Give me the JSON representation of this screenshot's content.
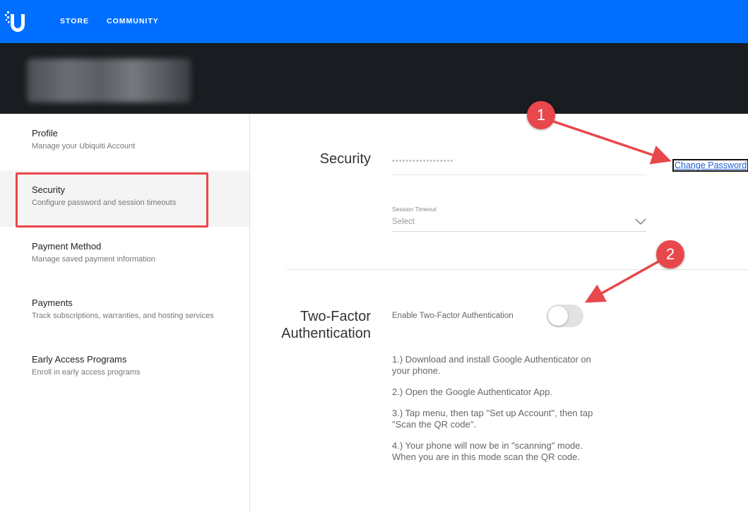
{
  "nav": {
    "store": "STORE",
    "community": "COMMUNITY",
    "brand_color": "#006fff"
  },
  "sidebar": {
    "items": [
      {
        "title": "Profile",
        "desc": "Manage your Ubiquiti Account"
      },
      {
        "title": "Security",
        "desc": "Configure password and session timeouts"
      },
      {
        "title": "Payment Method",
        "desc": "Manage saved payment information"
      },
      {
        "title": "Payments",
        "desc": "Track subscriptions, warranties, and hosting services"
      },
      {
        "title": "Early Access Programs",
        "desc": "Enroll in early access programs"
      }
    ]
  },
  "security": {
    "title": "Security",
    "password_mask": "••••••••••••••••••",
    "change_password": "Change Password",
    "session_label": "Session Timeout",
    "session_value": "Select"
  },
  "twofa": {
    "title_line1": "Two-Factor",
    "title_line2": "Authentication",
    "toggle_label": "Enable Two-Factor Authentication",
    "enabled": false,
    "steps": [
      "1.) Download and install Google Authenticator on your phone.",
      "2.) Open the Google Authenticator App.",
      "3.) Tap menu, then tap \"Set up Account\", then tap \"Scan the QR code\".",
      "4.) Your phone will now be in \"scanning\" mode. When you are in this mode scan the QR code."
    ]
  },
  "annotations": {
    "badge1": "1",
    "badge2": "2",
    "color": "#e8474b"
  }
}
